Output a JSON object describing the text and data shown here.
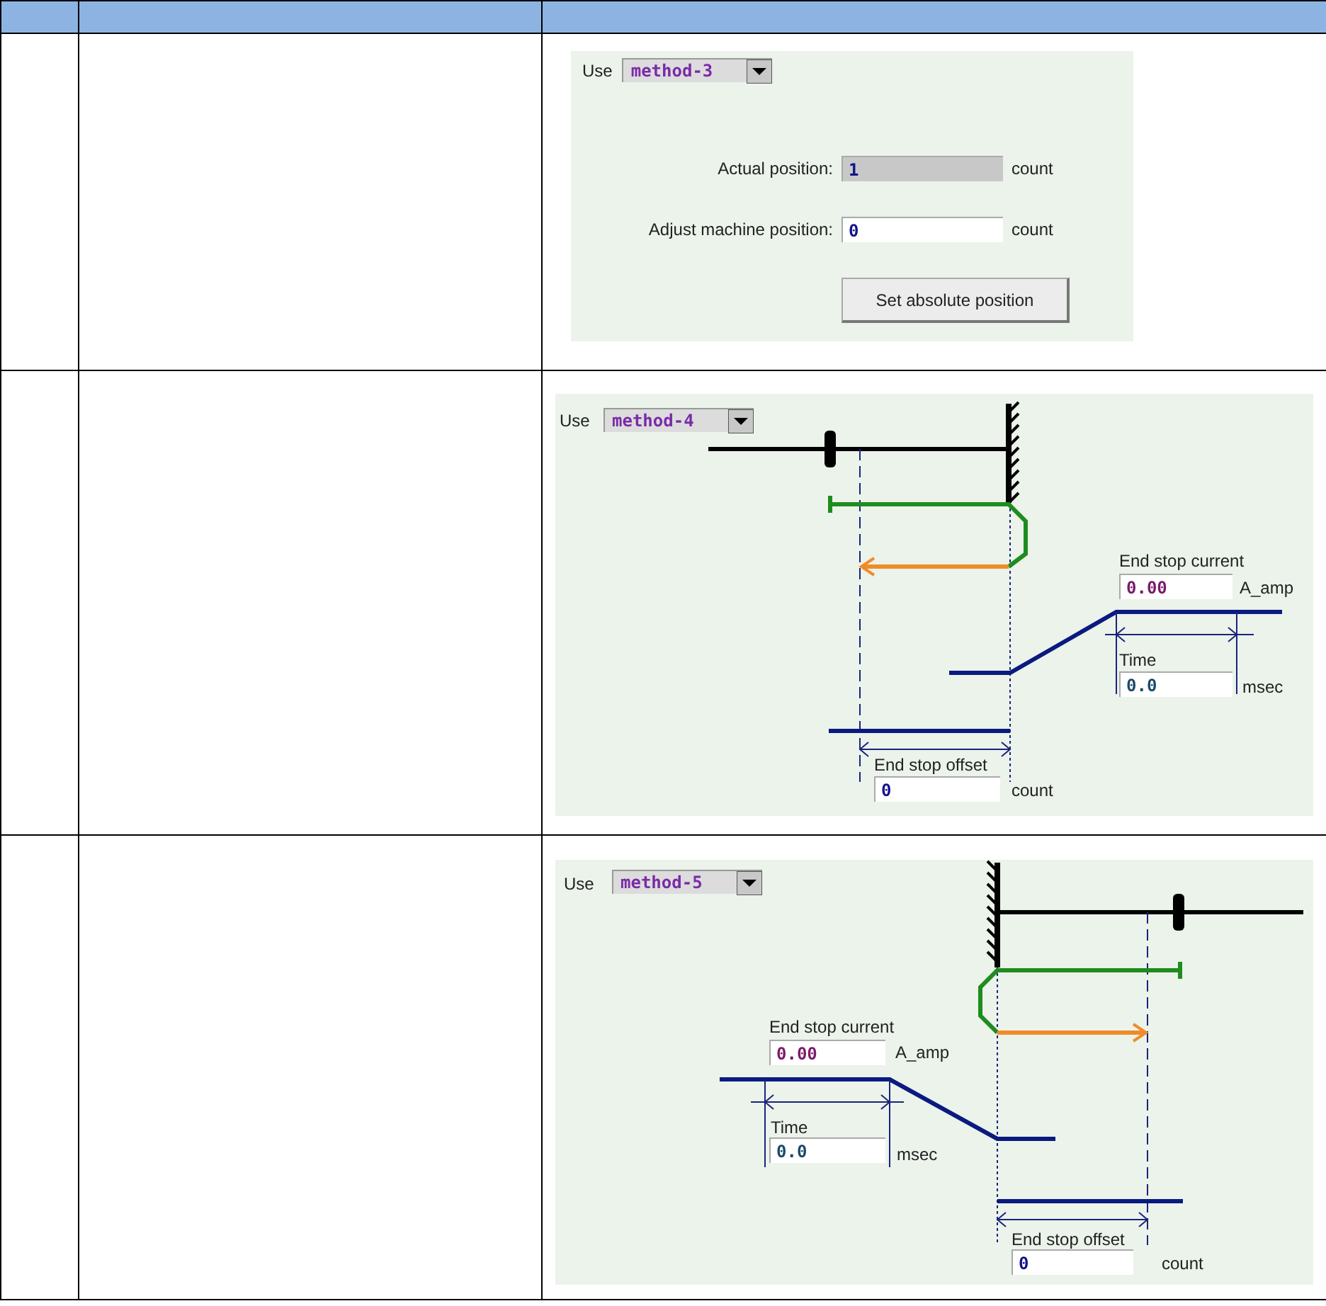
{
  "table": {
    "rows": [
      {
        "panel": {
          "kind": "set_position",
          "use_label": "Use",
          "method": "method-3",
          "fields": [
            {
              "label": "Actual position:",
              "value": "1",
              "unit": "count",
              "disabled": true
            },
            {
              "label": "Adjust machine position:",
              "value": "0",
              "unit": "count",
              "disabled": false
            }
          ],
          "button": "Set absolute position"
        }
      },
      {
        "panel": {
          "kind": "end_stop_positive",
          "use_label": "Use",
          "method": "method-4",
          "current": {
            "label": "End stop current",
            "value": "0.00",
            "unit": "A_amp"
          },
          "time": {
            "label": "Time",
            "value": "0.0",
            "unit": "msec"
          },
          "offset": {
            "label": "End stop offset",
            "value": "0",
            "unit": "count"
          }
        }
      },
      {
        "panel": {
          "kind": "end_stop_negative",
          "use_label": "Use",
          "method": "method-5",
          "current": {
            "label": "End stop current",
            "value": "0.00",
            "unit": "A_amp"
          },
          "time": {
            "label": "Time",
            "value": "0.0",
            "unit": "msec"
          },
          "offset": {
            "label": "End stop offset",
            "value": "0",
            "unit": "count"
          }
        }
      }
    ]
  }
}
